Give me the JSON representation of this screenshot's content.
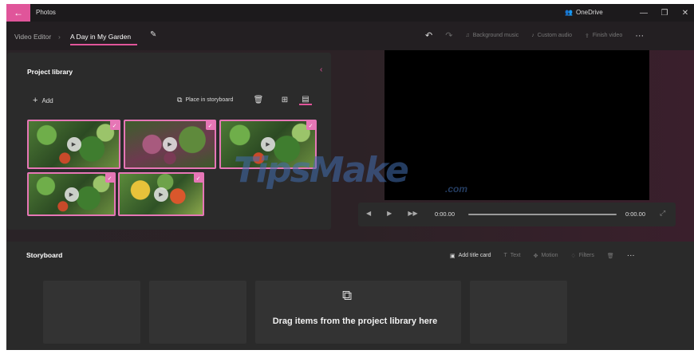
{
  "titlebar": {
    "back_icon": "arrow-left-icon",
    "app_name": "Photos",
    "onedrive_label": "OneDrive",
    "minimize_glyph": "—",
    "maximize_glyph": "❐",
    "close_glyph": "✕"
  },
  "toolbar": {
    "breadcrumb_root": "Video Editor",
    "breadcrumb_separator": "›",
    "project_name": "A Day in My Garden",
    "undo_glyph": "↶",
    "redo_glyph": "↷",
    "background_music": "Background music",
    "custom_audio": "Custom audio",
    "finish_video": "Finish video",
    "more_glyph": "···"
  },
  "library": {
    "title": "Project library",
    "collapse_glyph": "‹",
    "add_label": "Add",
    "add_glyph": "+",
    "place_label": "Place in storyboard",
    "delete_glyph": "🗑",
    "grid_glyph": "⊞",
    "list_glyph": "▤",
    "play_glyph": "▶",
    "check_glyph": "✓",
    "clip_count": 5
  },
  "player": {
    "rewind_glyph": "◀",
    "play_glyph": "▶",
    "forward_glyph": "▶▶",
    "time_current": "0:00.00",
    "time_total": "0:00.00",
    "expand_glyph": "⤢",
    "progress": 0
  },
  "storyboard": {
    "title": "Storyboard",
    "add_title_card": "Add title card",
    "text_tool": "Text",
    "motion_tool": "Motion",
    "filters_tool": "Filters",
    "delete_glyph": "🗑",
    "more_glyph": "···",
    "drop_hint": "Drag items from the project library here",
    "drop_icon": "⧉"
  },
  "watermark": {
    "brand": "TipsMake",
    "tld": ".com"
  },
  "colors": {
    "accent": "#e0559a",
    "background": "#1f1c1f",
    "panel": "#2b2b2b"
  }
}
